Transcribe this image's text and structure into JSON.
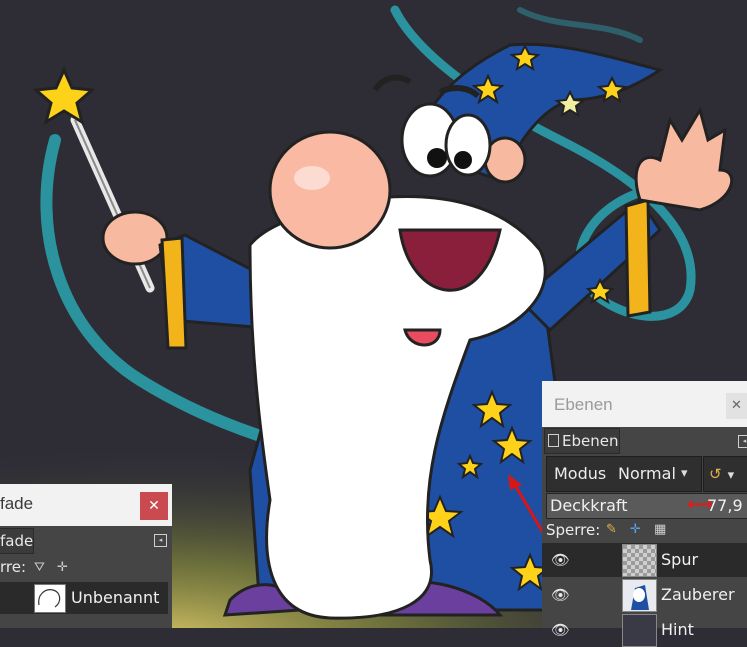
{
  "window_title": "",
  "canvas": {
    "background": "#2e2d36",
    "glow_color": "#2bb5c2"
  },
  "pfade_panel": {
    "title": "fade",
    "close_label": "✕",
    "tab_label": "fade",
    "lock_label": "rre:",
    "paths": [
      {
        "name": "Unbenannt",
        "visible": false
      }
    ]
  },
  "ebenen_panel": {
    "title": "Ebenen",
    "close_label": "✕",
    "tab_label": "Ebenen",
    "mode_label": "Modus",
    "mode_value": "Normal",
    "opacity_label": "Deckkraft",
    "opacity_value": "77,9",
    "lock_label": "Sperre:",
    "layers": [
      {
        "name": "Spur",
        "thumb": "checker",
        "selected": true
      },
      {
        "name": "Zauberer",
        "thumb": "wiz",
        "selected": false
      },
      {
        "name": "Hint",
        "thumb": "dark",
        "selected": false
      }
    ]
  },
  "colors": {
    "close_red": "#c94a4f",
    "panel_bg": "#454545",
    "row_selected": "#2a2a2a",
    "cursor_red": "#e01b1b"
  }
}
